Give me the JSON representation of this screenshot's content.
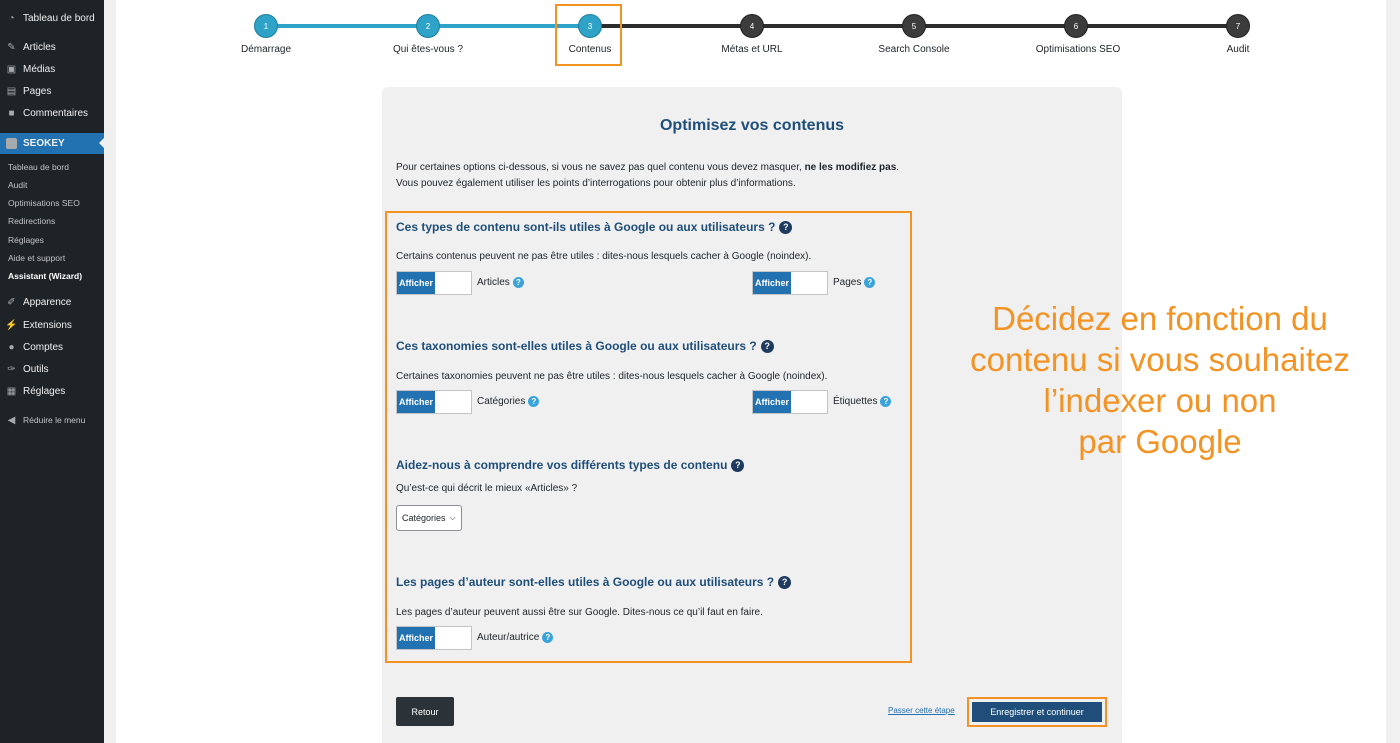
{
  "sidebar": {
    "items_top": [
      {
        "label": "Tableau de bord",
        "icon": "dashboard-icon"
      },
      {
        "label": "Articles",
        "icon": "pin-icon"
      },
      {
        "label": "Médias",
        "icon": "media-icon"
      },
      {
        "label": "Pages",
        "icon": "page-icon"
      },
      {
        "label": "Commentaires",
        "icon": "comment-icon"
      }
    ],
    "seokey": {
      "label": "SEOKEY",
      "icon": "seokey-icon"
    },
    "seokey_sub": [
      "Tableau de bord",
      "Audit",
      "Optimisations SEO",
      "Redirections",
      "Réglages",
      "Aide et support",
      "Assistant (Wizard)"
    ],
    "items_bottom": [
      {
        "label": "Apparence",
        "icon": "brush-icon"
      },
      {
        "label": "Extensions",
        "icon": "plugin-icon"
      },
      {
        "label": "Comptes",
        "icon": "users-icon"
      },
      {
        "label": "Outils",
        "icon": "wrench-icon"
      },
      {
        "label": "Réglages",
        "icon": "settings-icon"
      }
    ],
    "collapse": {
      "label": "Réduire le menu",
      "icon": "collapse-icon"
    }
  },
  "stepper": {
    "steps": [
      {
        "num": "1",
        "label": "Démarrage"
      },
      {
        "num": "2",
        "label": "Qui êtes-vous ?"
      },
      {
        "num": "3",
        "label": "Contenus"
      },
      {
        "num": "4",
        "label": "Métas et URL"
      },
      {
        "num": "5",
        "label": "Search Console"
      },
      {
        "num": "6",
        "label": "Optimisations SEO"
      },
      {
        "num": "7",
        "label": "Audit"
      }
    ],
    "current_step": 3
  },
  "card": {
    "title": "Optimisez vos contenus",
    "intro_line1_a": "Pour certaines options ci-dessous, si vous ne savez pas quel contenu vous devez masquer, ",
    "intro_line1_b": "ne les modifiez pas",
    "intro_line1_c": ".",
    "intro_line2": "Vous pouvez également utiliser les points d’interrogations pour obtenir plus d’informations."
  },
  "sections": {
    "content_types": {
      "title": "Ces types de contenu sont-ils utiles à Google ou aux utilisateurs ?",
      "desc": "Certains contenus peuvent ne pas être utiles : dites-nous lesquels cacher à Google (noindex).",
      "toggles": [
        {
          "on_label": "Afficher",
          "label": "Articles"
        },
        {
          "on_label": "Afficher",
          "label": "Pages"
        }
      ]
    },
    "taxonomies": {
      "title": "Ces taxonomies sont-elles utiles à Google ou aux utilisateurs ?",
      "desc": "Certaines taxonomies peuvent ne pas être utiles : dites-nous lesquels cacher à Google (noindex).",
      "toggles": [
        {
          "on_label": "Afficher",
          "label": "Catégories"
        },
        {
          "on_label": "Afficher",
          "label": "Étiquettes"
        }
      ]
    },
    "understand": {
      "title": "Aidez-nous à comprendre vos différents types de contenu",
      "desc": "Qu’est-ce qui décrit le mieux «Articles» ?",
      "select_value": "Catégories"
    },
    "authors": {
      "title": "Les pages d’auteur sont-elles utiles à Google ou aux utilisateurs ?",
      "desc": "Les pages d’auteur peuvent aussi être sur Google. Dites-nous ce qu’il faut en faire.",
      "toggles": [
        {
          "on_label": "Afficher",
          "label": "Auteur/autrice"
        }
      ]
    }
  },
  "footer": {
    "back_label": "Retour",
    "skip_label": "Passer cette étape",
    "continue_label": "Enregistrer et continuer"
  },
  "annotation": {
    "lines": [
      "Décidez en fonction du",
      "contenu si vous souhaitez",
      "l’indexer ou non",
      "par Google"
    ]
  },
  "help_glyph": "?",
  "colors": {
    "accent": "#2271b1",
    "highlight": "#f39324",
    "title": "#1e4e79",
    "step_done": "#2ea3c7",
    "step_todo": "#3c3c3c",
    "sidebar_bg": "#1d2327"
  }
}
